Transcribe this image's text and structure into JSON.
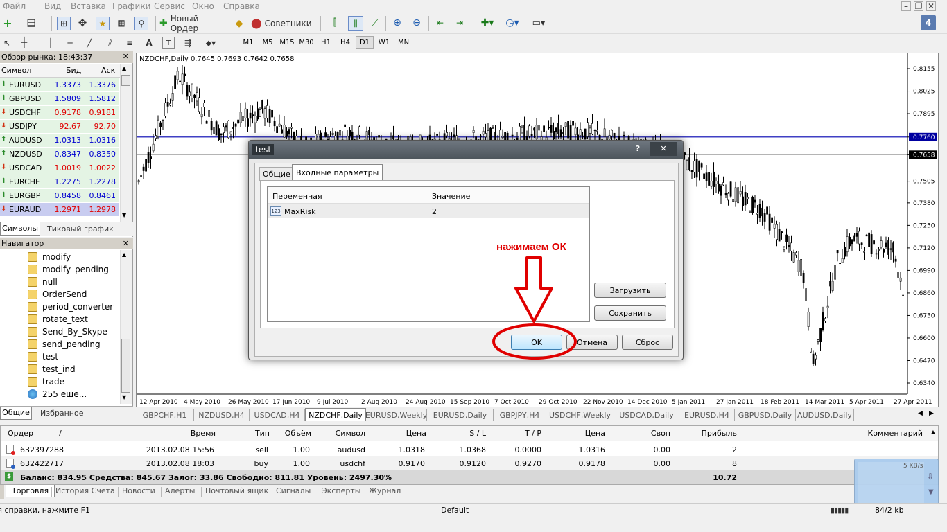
{
  "menu": [
    "Файл",
    "Вид",
    "Вставка",
    "Графики",
    "Сервис",
    "Окно",
    "Справка"
  ],
  "toolbar": {
    "new_order": "Новый Ордер",
    "advisors": "Советники"
  },
  "timeframes": [
    "M1",
    "M5",
    "M15",
    "M30",
    "H1",
    "H4",
    "D1",
    "W1",
    "MN"
  ],
  "active_tf": "D1",
  "window_badge": "4",
  "market_watch": {
    "title": "Обзор рынка: 18:43:37",
    "col_symbol": "Символ",
    "col_bid": "Бид",
    "col_ask": "Аск",
    "rows": [
      {
        "sym": "EURUSD",
        "bid": "1.3373",
        "ask": "1.3376",
        "dir": "up"
      },
      {
        "sym": "GBPUSD",
        "bid": "1.5809",
        "ask": "1.5812",
        "dir": "up"
      },
      {
        "sym": "USDCHF",
        "bid": "0.9178",
        "ask": "0.9181",
        "dir": "down"
      },
      {
        "sym": "USDJPY",
        "bid": "92.67",
        "ask": "92.70",
        "dir": "down"
      },
      {
        "sym": "AUDUSD",
        "bid": "1.0313",
        "ask": "1.0316",
        "dir": "up"
      },
      {
        "sym": "NZDUSD",
        "bid": "0.8347",
        "ask": "0.8350",
        "dir": "up"
      },
      {
        "sym": "USDCAD",
        "bid": "1.0019",
        "ask": "1.0022",
        "dir": "down"
      },
      {
        "sym": "EURCHF",
        "bid": "1.2275",
        "ask": "1.2278",
        "dir": "up"
      },
      {
        "sym": "EURGBP",
        "bid": "0.8458",
        "ask": "0.8461",
        "dir": "up"
      },
      {
        "sym": "EURAUD",
        "bid": "1.2971",
        "ask": "1.2978",
        "dir": "down"
      }
    ],
    "tab_symbols": "Символы",
    "tab_tick": "Тиковый график"
  },
  "navigator": {
    "title": "Навигатор",
    "items": [
      "modify",
      "modify_pending",
      "null",
      "OrderSend",
      "period_converter",
      "rotate_text",
      "Send_By_Skype",
      "send_pending",
      "test",
      "test_ind",
      "trade"
    ],
    "more": "255 еще...",
    "tab_common": "Общие",
    "tab_fav": "Избранное"
  },
  "chart": {
    "header": "NZDCHF,Daily  0.7645 0.7693 0.7642 0.7658",
    "price_labels": [
      "0.8155",
      "0.8025",
      "0.7895",
      "0.7760",
      "0.7658",
      "0.7505",
      "0.7380",
      "0.7250",
      "0.7120",
      "0.6990",
      "0.6860",
      "0.6730",
      "0.6600",
      "0.6470",
      "0.6340"
    ],
    "hline_price": "0.7760",
    "last_price": "0.7658",
    "dates": [
      "12 Apr 2010",
      "4 May 2010",
      "26 May 2010",
      "17 Jun 2010",
      "9 Jul 2010",
      "2 Aug 2010",
      "24 Aug 2010",
      "15 Sep 2010",
      "7 Oct 2010",
      "29 Oct 2010",
      "22 Nov 2010",
      "14 Dec 2010",
      "5 Jan 2011",
      "27 Jan 2011",
      "18 Feb 2011",
      "14 Mar 2011",
      "5 Apr 2011",
      "27 Apr 2011"
    ]
  },
  "chart_tabs": [
    "GBPCHF,H1",
    "NZDUSD,H4",
    "USDCAD,H4",
    "NZDCHF,Daily",
    "EURUSD,Weekly",
    "EURUSD,Daily",
    "GBPJPY,H4",
    "USDCHF,Weekly",
    "USDCAD,Daily",
    "EURUSD,H4",
    "GBPUSD,Daily",
    "AUDUSD,Daily"
  ],
  "active_chart_tab": "NZDCHF,Daily",
  "terminal": {
    "cols": [
      "Ордер",
      "/",
      "Время",
      "Тип",
      "Объём",
      "Символ",
      "Цена",
      "S / L",
      "T / P",
      "Цена",
      "Своп",
      "Прибыль",
      "Комментарий"
    ],
    "rows": [
      [
        "632397288",
        "2013.02.08 15:56",
        "sell",
        "1.00",
        "audusd",
        "1.0318",
        "1.0368",
        "0.0000",
        "1.0316",
        "0.00",
        "2"
      ],
      [
        "632422717",
        "2013.02.08 18:03",
        "buy",
        "1.00",
        "usdchf",
        "0.9170",
        "0.9120",
        "0.9270",
        "0.9178",
        "0.00",
        "8"
      ]
    ],
    "balance": "Баланс: 834.95  Средства: 845.67  Залог: 33.86  Свободно: 811.81  Уровень: 2497.30%",
    "total_profit": "10.72"
  },
  "term_tabs": [
    "Торговля",
    "История Счета",
    "Новости",
    "Алерты",
    "Почтовый ящик",
    "Сигналы",
    "Эксперты",
    "Журнал"
  ],
  "status": {
    "help": "Для справки, нажмите F1",
    "profile": "Default",
    "traffic": "84/2 kb"
  },
  "net_widget": {
    "speed": "5 KB/s"
  },
  "dialog": {
    "title": "test",
    "help": "?",
    "close": "✕",
    "tab_common": "Общие",
    "tab_inputs": "Входные параметры",
    "col_var": "Переменная",
    "col_val": "Значение",
    "param_icon_label": "123",
    "param_name": "MaxRisk",
    "param_value": "2",
    "load": "Загрузить",
    "save": "Сохранить",
    "ok": "OK",
    "cancel": "Отмена",
    "reset": "Сброс"
  },
  "annotation": {
    "text": "нажимаем ОК",
    "color": "#e00000"
  }
}
